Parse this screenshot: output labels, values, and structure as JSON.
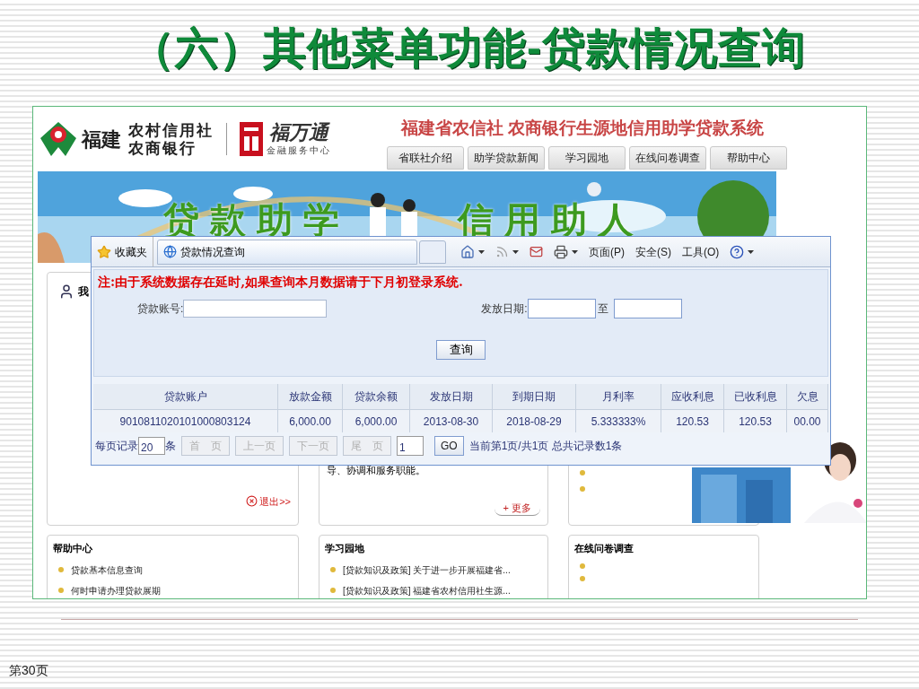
{
  "slide": {
    "title": "（六）其他菜单功能-贷款情况查询",
    "page_number": "第30页"
  },
  "site": {
    "logo": {
      "name": "福建",
      "org_lines": [
        "农村信用社",
        "农商银行"
      ],
      "brand": "福万通",
      "brand_sub": "金融服务中心"
    },
    "title": "福建省农信社 农商银行生源地信用助学贷款系统",
    "nav": [
      {
        "label": "省联社介绍"
      },
      {
        "label": "助学贷款新闻"
      },
      {
        "label": "学习园地"
      },
      {
        "label": "在线问卷调查"
      },
      {
        "label": "帮助中心"
      }
    ],
    "banner": {
      "slogans": [
        "贷款助学",
        "信用助人"
      ]
    },
    "top_panels": [
      {
        "kind": "user",
        "title": "我",
        "link": "退出>>"
      },
      {
        "kind": "text",
        "text": "导、协调和服务职能。",
        "link": "+ 更多"
      },
      {
        "kind": "bullets",
        "items": [
          {
            "kind": "bullet"
          },
          {
            "kind": "bullet"
          }
        ]
      }
    ],
    "bottom_panels": [
      {
        "title": "帮助中心",
        "items": [
          "贷款基本信息查询",
          "何时申请办理贷款展期"
        ]
      },
      {
        "title": "学习园地",
        "items": [
          "[贷款知识及政策] 关于进一步开展福建省...",
          "[贷款知识及政策] 福建省农村信用社生源..."
        ]
      },
      {
        "title": "在线问卷调查",
        "items": [
          {
            "kind": "bullet"
          },
          {
            "kind": "bullet"
          }
        ]
      }
    ]
  },
  "popup": {
    "favorites": "收藏夹",
    "tab": "贷款情况查询",
    "toolbar": [
      {
        "kind": "home"
      },
      {
        "kind": "feed",
        "disabled": true
      },
      {
        "kind": "mail"
      },
      {
        "kind": "print"
      },
      {
        "kind": "menu",
        "label": "页面(P)"
      },
      {
        "kind": "menu",
        "label": "安全(S)"
      },
      {
        "kind": "menu",
        "label": "工具(O)"
      },
      {
        "kind": "help"
      }
    ],
    "notice": "注:由于系统数据存在延时,如果查询本月数据请于下月初登录系统.",
    "account_label": "贷款账号:",
    "date_label": "发放日期:",
    "date_to": "至",
    "query_button": "查询",
    "table": {
      "columns": [
        "贷款账户",
        "放款金额",
        "贷款余额",
        "发放日期",
        "到期日期",
        "月利率",
        "应收利息",
        "已收利息",
        "欠息"
      ],
      "rows": [
        [
          "9010811020101000803124",
          "6,000.00",
          "6,000.00",
          "2013-08-30",
          "2018-08-29",
          "5.333333%",
          "120.53",
          "120.53",
          "00.00"
        ]
      ]
    },
    "pager": {
      "per_page_label": "每页记录",
      "per_page": "20",
      "unit": "条",
      "buttons": [
        {
          "label": "首　页",
          "disabled": true
        },
        {
          "label": "上一页",
          "disabled": true
        },
        {
          "label": "下一页",
          "disabled": true
        },
        {
          "label": "尾　页",
          "disabled": true
        }
      ],
      "page": "1",
      "go": "GO",
      "summary": "当前第1页/共1页 总共记录数1条"
    }
  }
}
